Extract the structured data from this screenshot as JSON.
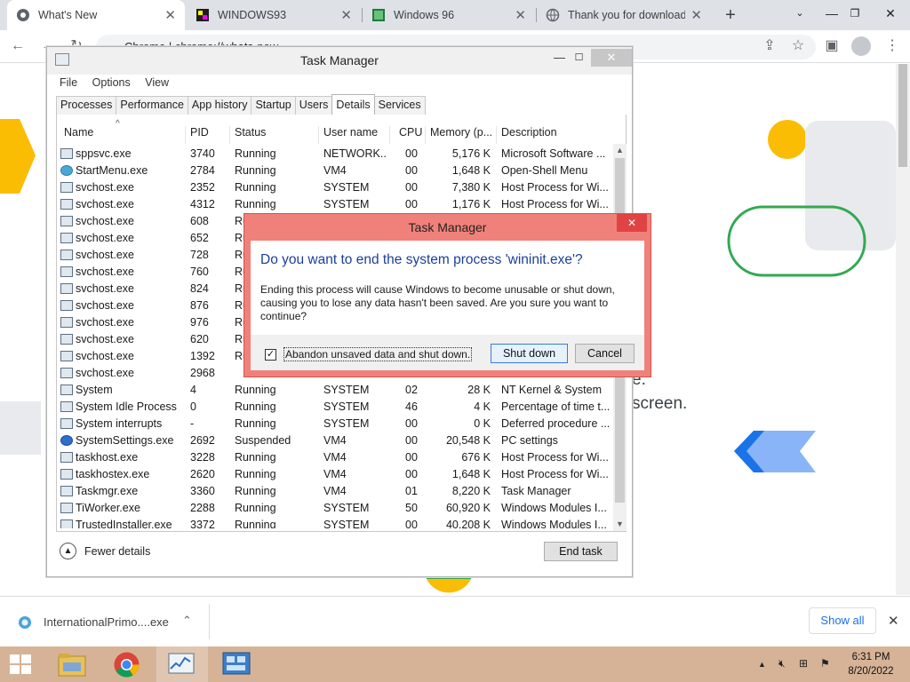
{
  "browser": {
    "tabs": [
      {
        "title": "What's New"
      },
      {
        "title": "WINDOWS93"
      },
      {
        "title": "Windows 96"
      },
      {
        "title": "Thank you for download"
      }
    ],
    "address": "Chrome  |  chrome://whats-new"
  },
  "page": {
    "line1": "e.",
    "line2": "screen."
  },
  "download_shelf": {
    "filename": "InternationalPrimo....exe",
    "show_all": "Show all"
  },
  "taskbar": {
    "time": "6:31 PM",
    "date": "8/20/2022"
  },
  "task_manager": {
    "title": "Task Manager",
    "menu": [
      "File",
      "Options",
      "View"
    ],
    "tabs": [
      "Processes",
      "Performance",
      "App history",
      "Startup",
      "Users",
      "Details",
      "Services"
    ],
    "selected_tab": "Details",
    "columns": [
      "Name",
      "PID",
      "Status",
      "User name",
      "CPU",
      "Memory (p...",
      "Description"
    ],
    "rows": [
      {
        "name": "sppsvc.exe",
        "pid": "3740",
        "status": "Running",
        "user": "NETWORK...",
        "cpu": "00",
        "mem": "5,176 K",
        "desc": "Microsoft Software ...",
        "icon": "app"
      },
      {
        "name": "StartMenu.exe",
        "pid": "2784",
        "status": "Running",
        "user": "VM4",
        "cpu": "00",
        "mem": "1,648 K",
        "desc": "Open-Shell Menu",
        "icon": "globe"
      },
      {
        "name": "svchost.exe",
        "pid": "2352",
        "status": "Running",
        "user": "SYSTEM",
        "cpu": "00",
        "mem": "7,380 K",
        "desc": "Host Process for Wi...",
        "icon": "app"
      },
      {
        "name": "svchost.exe",
        "pid": "4312",
        "status": "Running",
        "user": "SYSTEM",
        "cpu": "00",
        "mem": "1,176 K",
        "desc": "Host Process for Wi...",
        "icon": "app"
      },
      {
        "name": "svchost.exe",
        "pid": "608",
        "status": "Ru",
        "user": "",
        "cpu": "",
        "mem": "",
        "desc": "",
        "icon": "app"
      },
      {
        "name": "svchost.exe",
        "pid": "652",
        "status": "Ru",
        "user": "",
        "cpu": "",
        "mem": "",
        "desc": "",
        "icon": "app"
      },
      {
        "name": "svchost.exe",
        "pid": "728",
        "status": "Ru",
        "user": "",
        "cpu": "",
        "mem": "",
        "desc": "",
        "icon": "app"
      },
      {
        "name": "svchost.exe",
        "pid": "760",
        "status": "Ru",
        "user": "",
        "cpu": "",
        "mem": "",
        "desc": "",
        "icon": "app"
      },
      {
        "name": "svchost.exe",
        "pid": "824",
        "status": "Ru",
        "user": "",
        "cpu": "",
        "mem": "",
        "desc": "",
        "icon": "app"
      },
      {
        "name": "svchost.exe",
        "pid": "876",
        "status": "Ru",
        "user": "",
        "cpu": "",
        "mem": "",
        "desc": "",
        "icon": "app"
      },
      {
        "name": "svchost.exe",
        "pid": "976",
        "status": "Ru",
        "user": "",
        "cpu": "",
        "mem": "",
        "desc": "",
        "icon": "app"
      },
      {
        "name": "svchost.exe",
        "pid": "620",
        "status": "Ru",
        "user": "",
        "cpu": "",
        "mem": "",
        "desc": "",
        "icon": "app"
      },
      {
        "name": "svchost.exe",
        "pid": "1392",
        "status": "Ru",
        "user": "",
        "cpu": "",
        "mem": "",
        "desc": "",
        "icon": "app"
      },
      {
        "name": "svchost.exe",
        "pid": "2968",
        "status": "",
        "user": "",
        "cpu": "",
        "mem": "",
        "desc": "",
        "icon": "app"
      },
      {
        "name": "System",
        "pid": "4",
        "status": "Running",
        "user": "SYSTEM",
        "cpu": "02",
        "mem": "28 K",
        "desc": "NT Kernel & System",
        "icon": "app"
      },
      {
        "name": "System Idle Process",
        "pid": "0",
        "status": "Running",
        "user": "SYSTEM",
        "cpu": "46",
        "mem": "4 K",
        "desc": "Percentage of time t...",
        "icon": "app"
      },
      {
        "name": "System interrupts",
        "pid": "-",
        "status": "Running",
        "user": "SYSTEM",
        "cpu": "00",
        "mem": "0 K",
        "desc": "Deferred procedure ...",
        "icon": "app"
      },
      {
        "name": "SystemSettings.exe",
        "pid": "2692",
        "status": "Suspended",
        "user": "VM4",
        "cpu": "00",
        "mem": "20,548 K",
        "desc": "PC settings",
        "icon": "gear"
      },
      {
        "name": "taskhost.exe",
        "pid": "3228",
        "status": "Running",
        "user": "VM4",
        "cpu": "00",
        "mem": "676 K",
        "desc": "Host Process for Wi...",
        "icon": "app"
      },
      {
        "name": "taskhostex.exe",
        "pid": "2620",
        "status": "Running",
        "user": "VM4",
        "cpu": "00",
        "mem": "1,648 K",
        "desc": "Host Process for Wi...",
        "icon": "app"
      },
      {
        "name": "Taskmgr.exe",
        "pid": "3360",
        "status": "Running",
        "user": "VM4",
        "cpu": "01",
        "mem": "8,220 K",
        "desc": "Task Manager",
        "icon": "app"
      },
      {
        "name": "TiWorker.exe",
        "pid": "2288",
        "status": "Running",
        "user": "SYSTEM",
        "cpu": "50",
        "mem": "60,920 K",
        "desc": "Windows Modules I...",
        "icon": "app"
      },
      {
        "name": "TrustedInstaller.exe",
        "pid": "3372",
        "status": "Running",
        "user": "SYSTEM",
        "cpu": "00",
        "mem": "40,208 K",
        "desc": "Windows Modules I...",
        "icon": "app"
      }
    ],
    "fewer_details": "Fewer details",
    "end_task": "End task"
  },
  "dialog": {
    "title": "Task Manager",
    "question": "Do you want to end the system process 'wininit.exe'?",
    "body": "Ending this process will cause Windows to become unusable or shut down, causing you to lose any data hasn't been saved. Are you sure you want to continue?",
    "checkbox_label": "Abandon unsaved data and shut down.",
    "checkbox_checked": true,
    "shutdown_label": "Shut down",
    "cancel_label": "Cancel"
  },
  "colors": {
    "dialog_border": "#f0817a",
    "taskbar": "#d6b396",
    "link_blue": "#1a73e8",
    "question_blue": "#1b3f9a"
  }
}
